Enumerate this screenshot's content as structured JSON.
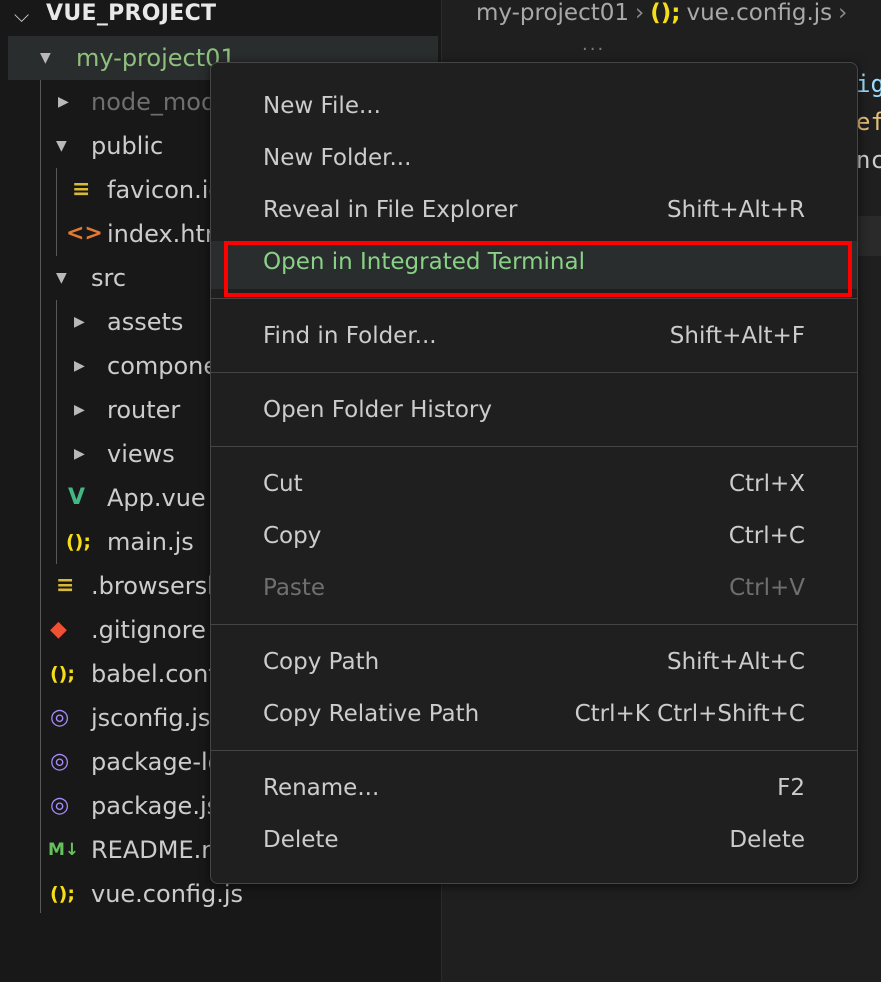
{
  "explorer": {
    "title": "VUE_PROJECT",
    "items": [
      {
        "label": "my-project01",
        "icon": "chevron-down-icon"
      },
      {
        "label": "node_modules",
        "icon": "chevron-right-icon"
      },
      {
        "label": "public",
        "icon": "chevron-down-icon"
      },
      {
        "label": "favicon.ico",
        "icon": "lines-file-icon"
      },
      {
        "label": "index.html",
        "icon": "html-file-icon"
      },
      {
        "label": "src",
        "icon": "chevron-down-icon"
      },
      {
        "label": "assets",
        "icon": "chevron-right-icon"
      },
      {
        "label": "components",
        "icon": "chevron-right-icon"
      },
      {
        "label": "router",
        "icon": "chevron-right-icon"
      },
      {
        "label": "views",
        "icon": "chevron-right-icon"
      },
      {
        "label": "App.vue",
        "icon": "vue-file-icon"
      },
      {
        "label": "main.js",
        "icon": "js-file-icon"
      },
      {
        "label": ".browserslistrc",
        "icon": "lines-file-icon"
      },
      {
        "label": ".gitignore",
        "icon": "git-file-icon"
      },
      {
        "label": "babel.config.js",
        "icon": "js-file-icon"
      },
      {
        "label": "jsconfig.json",
        "icon": "json-ring-icon"
      },
      {
        "label": "package-lock.json",
        "icon": "json-ring-icon"
      },
      {
        "label": "package.json",
        "icon": "json-ring-icon"
      },
      {
        "label": "README.md",
        "icon": "markdown-file-icon"
      },
      {
        "label": "vue.config.js",
        "icon": "js-file-icon"
      }
    ]
  },
  "breadcrumb": {
    "folder": "my-project01",
    "file": "vue.config.js",
    "file_icon": "js-file-icon",
    "overflow": "..."
  },
  "editor": {
    "code_fragments": [
      "ig",
      "ef",
      "nc"
    ]
  },
  "menu": {
    "items": [
      {
        "label": "New File...",
        "shortcut": ""
      },
      {
        "label": "New Folder...",
        "shortcut": ""
      },
      {
        "label": "Reveal in File Explorer",
        "shortcut": "Shift+Alt+R"
      },
      {
        "label": "Open in Integrated Terminal",
        "shortcut": "",
        "highlighted": true
      },
      {
        "label": "Find in Folder...",
        "shortcut": "Shift+Alt+F"
      },
      {
        "label": "Open Folder History",
        "shortcut": ""
      },
      {
        "label": "Cut",
        "shortcut": "Ctrl+X"
      },
      {
        "label": "Copy",
        "shortcut": "Ctrl+C"
      },
      {
        "label": "Paste",
        "shortcut": "Ctrl+V",
        "disabled": true
      },
      {
        "label": "Copy Path",
        "shortcut": "Shift+Alt+C"
      },
      {
        "label": "Copy Relative Path",
        "shortcut": "Ctrl+K Ctrl+Shift+C"
      },
      {
        "label": "Rename...",
        "shortcut": "F2"
      },
      {
        "label": "Delete",
        "shortcut": "Delete"
      }
    ]
  },
  "colors": {
    "highlight_box": "#ff0000",
    "highlight_text": "#89d185",
    "folder_selected_text": "#8ec07c"
  }
}
